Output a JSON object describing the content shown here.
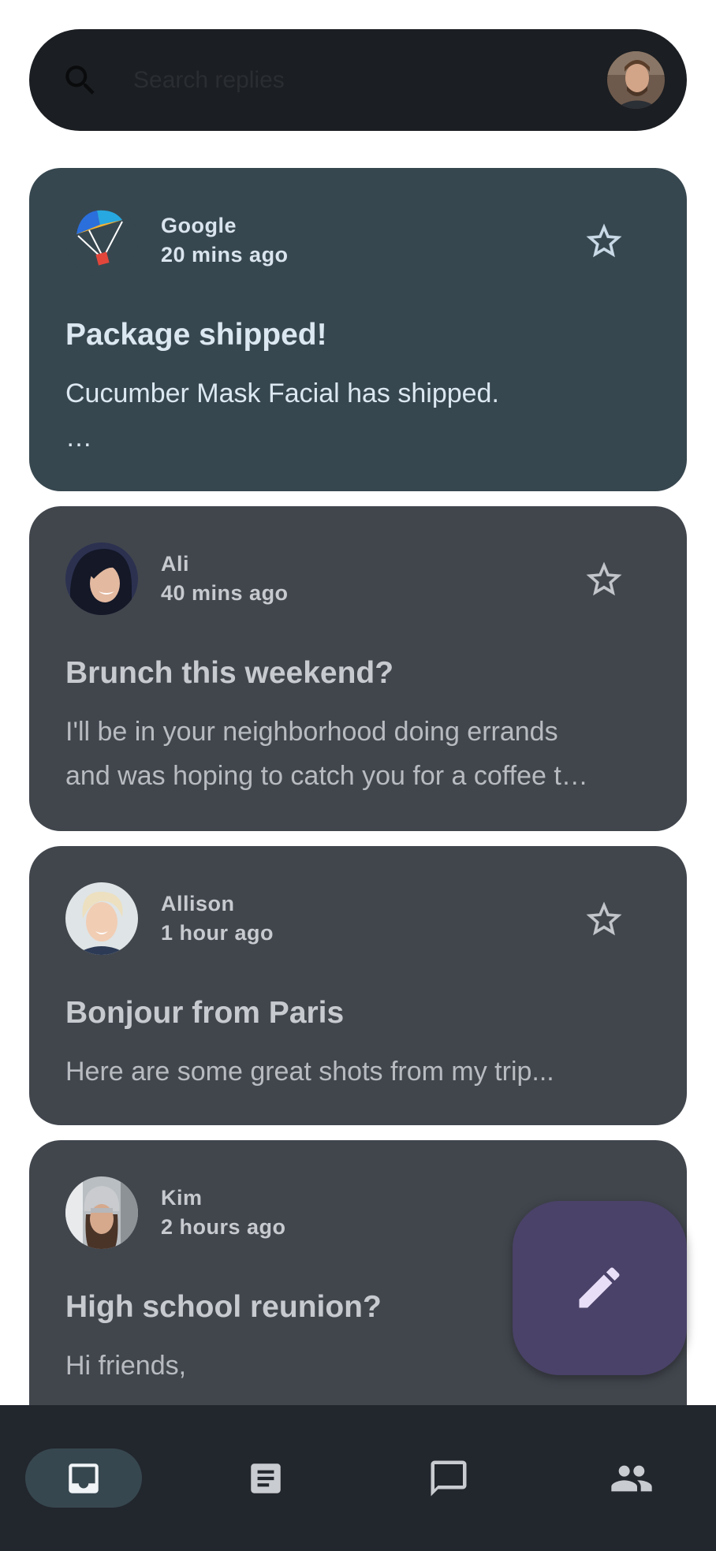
{
  "search": {
    "placeholder": "Search replies",
    "icon": "search-icon",
    "profile_avatar": "user-profile-photo"
  },
  "emails": [
    {
      "sender": "Google",
      "time": "20 mins ago",
      "subject": "Package shipped!",
      "preview_lines": [
        "Cucumber Mask Facial has shipped.",
        "…"
      ],
      "starred": false,
      "selected": true,
      "avatar": "google-parachute-logo"
    },
    {
      "sender": "Ali",
      "time": "40 mins ago",
      "subject": "Brunch this weekend?",
      "preview_lines": [
        "I'll be in your neighborhood doing errands",
        "and was hoping to catch you for a coffee t…"
      ],
      "starred": false,
      "selected": false,
      "avatar": "ali-photo"
    },
    {
      "sender": "Allison",
      "time": "1 hour ago",
      "subject": "Bonjour from Paris",
      "preview_lines": [
        "Here are some great shots from my trip..."
      ],
      "starred": false,
      "selected": false,
      "avatar": "allison-photo"
    },
    {
      "sender": "Kim",
      "time": "2 hours ago",
      "subject": "High school reunion?",
      "preview_lines": [
        "Hi friends,"
      ],
      "starred": false,
      "selected": false,
      "avatar": "kim-photo"
    }
  ],
  "fab": {
    "icon": "pencil-icon",
    "action": "compose"
  },
  "bottom_nav": [
    {
      "icon": "inbox-icon",
      "selected": true
    },
    {
      "icon": "article-icon",
      "selected": false
    },
    {
      "icon": "chat-icon",
      "selected": false
    },
    {
      "icon": "people-icon",
      "selected": false
    }
  ],
  "colors": {
    "search_bar": "#1b1e22",
    "card": "#41464d",
    "card_selected": "#37474f",
    "fab": "#4a4268",
    "bottom_nav": "#22262d",
    "nav_indicator": "#37474f"
  }
}
